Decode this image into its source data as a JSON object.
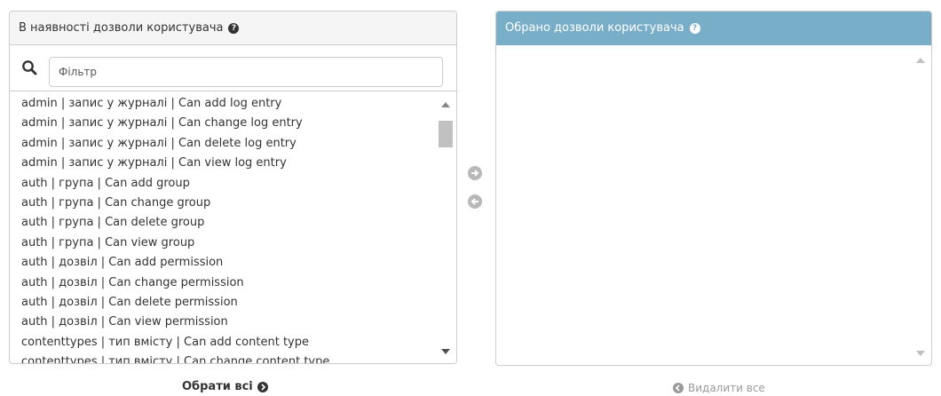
{
  "available": {
    "title": "В наявності дозволи користувача",
    "filter_placeholder": "Фільтр",
    "items": [
      "admin | запис у журналі | Can add log entry",
      "admin | запис у журналі | Can change log entry",
      "admin | запис у журналі | Can delete log entry",
      "admin | запис у журналі | Can view log entry",
      "auth | група | Can add group",
      "auth | група | Can change group",
      "auth | група | Can delete group",
      "auth | група | Can view group",
      "auth | дозвіл | Can add permission",
      "auth | дозвіл | Can change permission",
      "auth | дозвіл | Can delete permission",
      "auth | дозвіл | Can view permission",
      "contenttypes | тип вмісту | Can add content type",
      "contenttypes | тип вмісту | Can change content type"
    ],
    "choose_all_label": "Обрати всі"
  },
  "chosen": {
    "title": "Обрано дозволи користувача",
    "items": [],
    "remove_all_label": "Видалити все"
  },
  "colors": {
    "chosen_header": "#79aec8",
    "border": "#cccccc",
    "text": "#333333",
    "muted": "#999999"
  },
  "icons": {
    "help": "question-circle-icon",
    "search": "magnifier-icon",
    "add": "arrow-right-circle-icon",
    "remove": "arrow-left-circle-icon"
  }
}
